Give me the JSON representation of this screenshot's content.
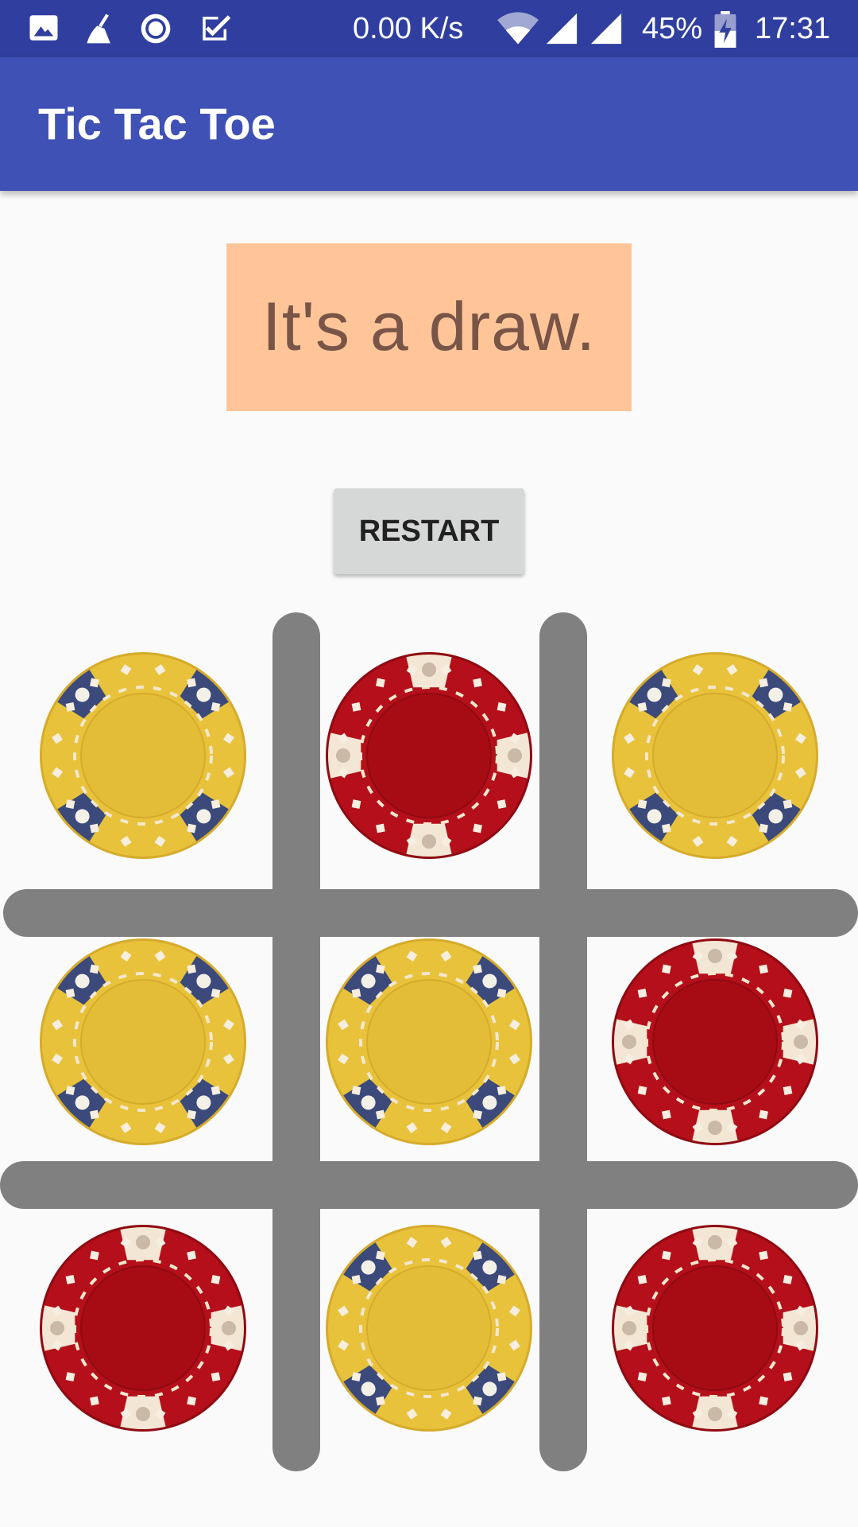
{
  "status_bar": {
    "network_speed": "0.00 K/s",
    "battery": "45%",
    "time": "17:31",
    "left_icons": [
      "image-icon",
      "broom-icon",
      "circle-record-icon",
      "checkbox-icon"
    ],
    "right_icons": [
      "wifi-icon",
      "signal-icon",
      "signal-icon",
      "battery-charging-icon"
    ]
  },
  "app_bar": {
    "title": "Tic Tac Toe",
    "color": "#3f51b5"
  },
  "result": {
    "message": "It's a draw.",
    "background": "#ffc599",
    "text_color": "#795548"
  },
  "restart_label": "RESTART",
  "board": {
    "cells": [
      [
        "yellow",
        "red",
        "yellow"
      ],
      [
        "yellow",
        "yellow",
        "red"
      ],
      [
        "red",
        "yellow",
        "red"
      ]
    ],
    "chip_colors": {
      "yellow": "#e8c23a",
      "red": "#b40f1a",
      "grid": "#808080"
    }
  }
}
